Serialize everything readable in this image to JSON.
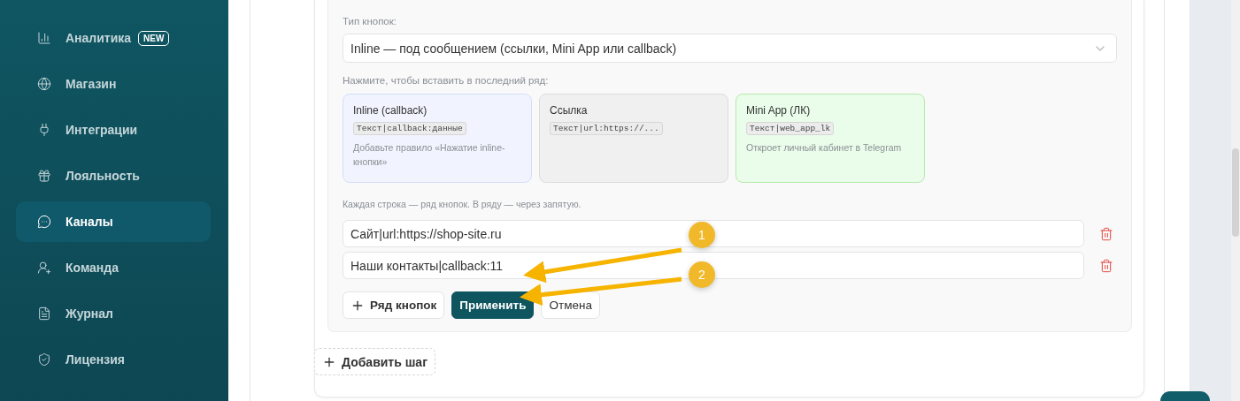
{
  "sidebar": {
    "items": [
      {
        "label": "Аналитика",
        "badge": "NEW",
        "selected": false
      },
      {
        "label": "Магазин",
        "selected": false
      },
      {
        "label": "Интеграции",
        "selected": false
      },
      {
        "label": "Лояльность",
        "selected": false
      },
      {
        "label": "Каналы",
        "selected": true
      },
      {
        "label": "Команда",
        "selected": false
      },
      {
        "label": "Журнал",
        "selected": false
      },
      {
        "label": "Лицензия",
        "selected": false
      }
    ]
  },
  "editor": {
    "type_label": "Тип кнопок:",
    "type_select": {
      "value": "Inline — под сообщением (ссылки, Mini App или callback)"
    },
    "insert_hint": "Нажмите, чтобы вставить в последний ряд:",
    "templates": [
      {
        "kind": "callback",
        "title": "Inline (callback)",
        "code": "Текст|callback:данные",
        "description": "Добавьте правило «Нажатие inline-кнопки»"
      },
      {
        "kind": "link",
        "title": "Ссылка",
        "code": "Текст|url:https://..."
      },
      {
        "kind": "miniapp",
        "title": "Mini App (ЛК)",
        "code": "Текст|web_app_lk",
        "description": "Откроет личный кабинет в Telegram"
      }
    ],
    "rows_hint": "Каждая строка — ряд кнопок. В ряду — через запятую.",
    "rows": [
      {
        "value": "Сайт|url:https://shop-site.ru"
      },
      {
        "value": "Наши контакты|callback:11"
      }
    ],
    "add_row": "Ряд кнопок",
    "apply": "Применить",
    "cancel": "Отмена"
  },
  "add_step": "Добавить шаг",
  "annotations": [
    {
      "label": "1"
    },
    {
      "label": "2"
    }
  ]
}
